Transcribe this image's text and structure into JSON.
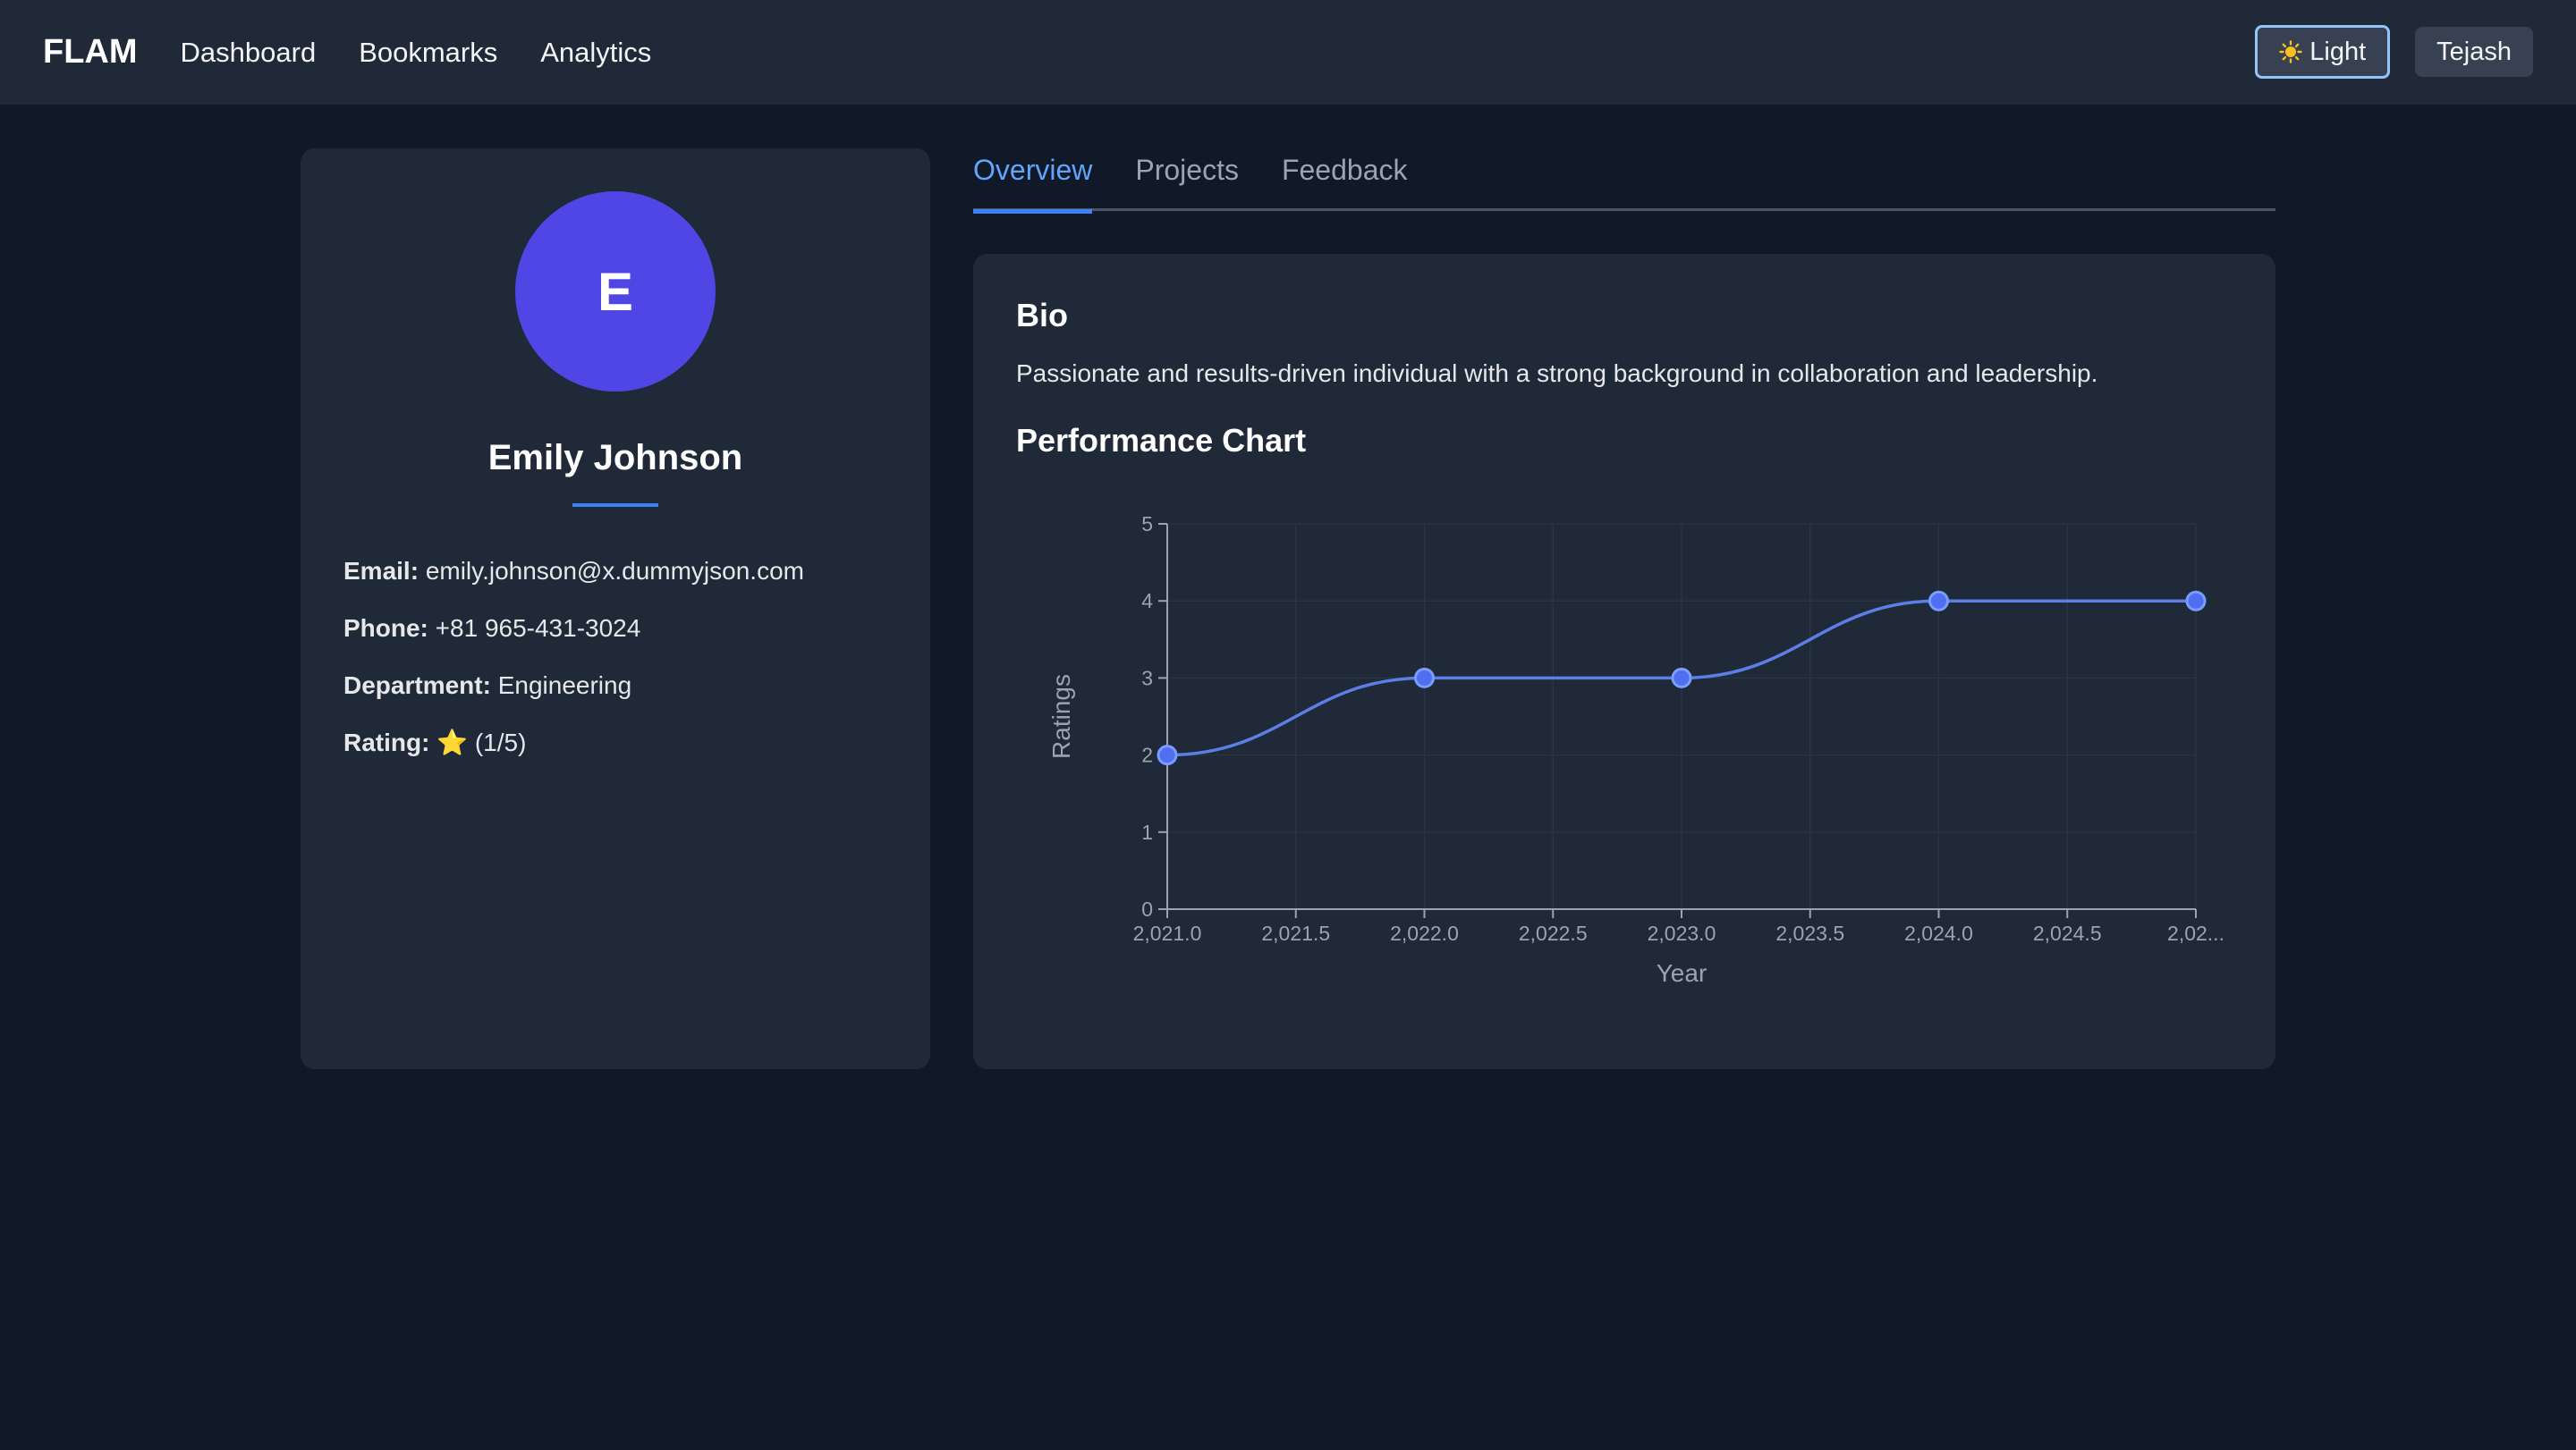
{
  "header": {
    "brand": "FLAM",
    "nav": [
      "Dashboard",
      "Bookmarks",
      "Analytics"
    ],
    "theme_icon": "sun-icon",
    "theme_label": "Light",
    "user_label": "Tejash"
  },
  "profile": {
    "avatar_letter": "E",
    "name": "Emily Johnson",
    "fields": [
      {
        "label": "Email:",
        "value": "emily.johnson@x.dummyjson.com"
      },
      {
        "label": "Phone:",
        "value": "+81 965-431-3024"
      },
      {
        "label": "Department:",
        "value": "Engineering"
      },
      {
        "label": "Rating:",
        "value": "⭐ (1/5)"
      }
    ]
  },
  "tabs": [
    "Overview",
    "Projects",
    "Feedback"
  ],
  "active_tab": "Overview",
  "content": {
    "bio_title": "Bio",
    "bio_text": "Passionate and results-driven individual with a strong background in collaboration and leadership.",
    "chart_title": "Performance Chart"
  },
  "colors": {
    "accent": "#3b82f6",
    "line": "#5b7fe6",
    "point": "#4f6ef0"
  },
  "chart_data": {
    "type": "line",
    "x": [
      2021,
      2022,
      2023,
      2024,
      2025
    ],
    "series": [
      {
        "values": [
          2,
          3,
          3,
          4,
          4
        ]
      }
    ],
    "xlabel": "Year",
    "ylabel": "Ratings",
    "xlim": [
      2021,
      2025
    ],
    "ylim": [
      0,
      5
    ],
    "x_ticks": [
      "2,021.0",
      "2,021.5",
      "2,022.0",
      "2,022.5",
      "2,023.0",
      "2,023.5",
      "2,024.0",
      "2,024.5",
      "2,02..."
    ],
    "y_ticks": [
      "0",
      "1",
      "2",
      "3",
      "4",
      "5"
    ],
    "grid": true
  }
}
